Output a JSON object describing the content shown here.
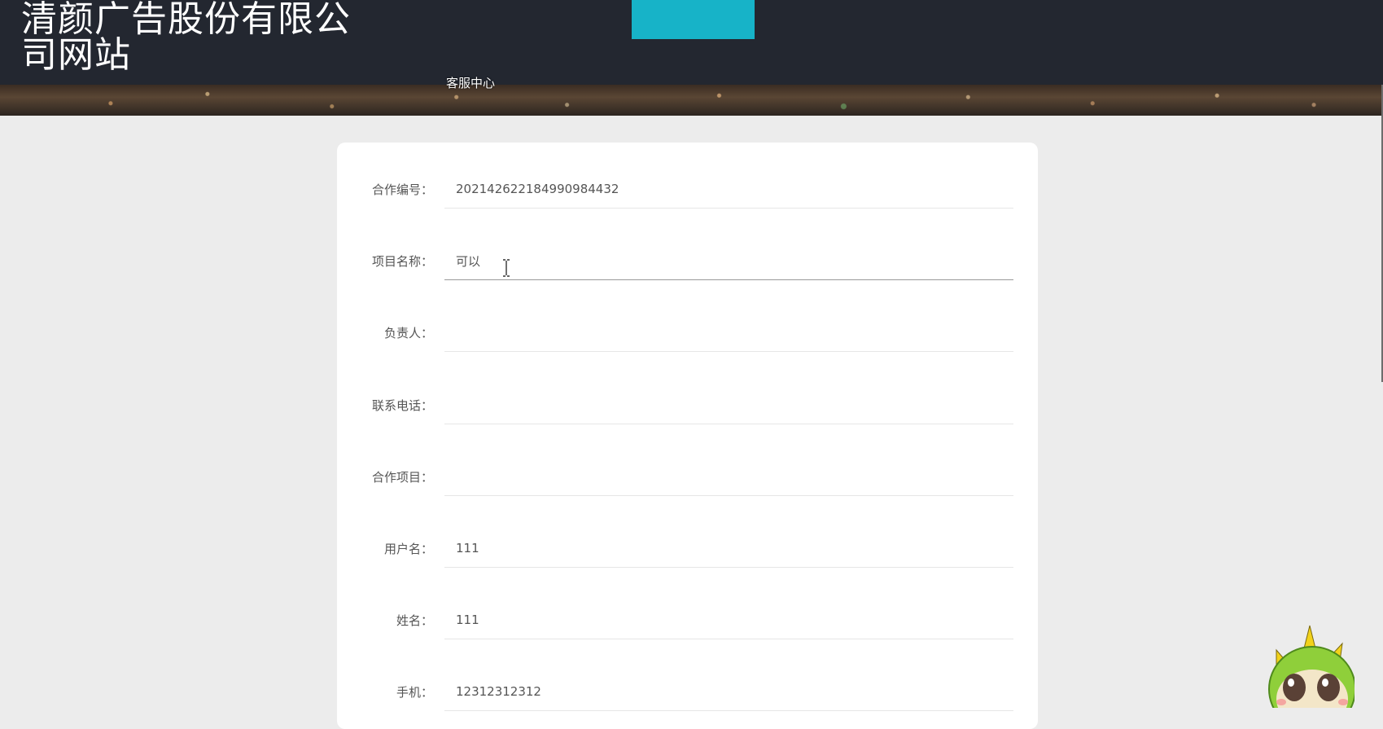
{
  "header": {
    "site_title": "清颜广告股份有限公司网站",
    "nav": {
      "customer_service": "客服中心"
    }
  },
  "form": {
    "fields": [
      {
        "label": "合作编号：",
        "value": "20214262218499098443​2",
        "placeholder": ""
      },
      {
        "label": "项目名称：",
        "value": "可以",
        "placeholder": ""
      },
      {
        "label": "负责人：",
        "value": "",
        "placeholder": ""
      },
      {
        "label": "联系电话：",
        "value": "",
        "placeholder": ""
      },
      {
        "label": "合作项目：",
        "value": "",
        "placeholder": ""
      },
      {
        "label": "用户名：",
        "value": "111",
        "placeholder": ""
      },
      {
        "label": "姓名：",
        "value": "111",
        "placeholder": ""
      },
      {
        "label": "手机：",
        "value": "12312312312",
        "placeholder": ""
      }
    ]
  },
  "colors": {
    "header_bg": "#232730",
    "nav_active": "#17b3c8",
    "page_bg": "#ececec",
    "card_bg": "#ffffff"
  },
  "icons": {
    "text_cursor": "i-beam-cursor-icon",
    "mascot": "green-dinosaur-mascot-icon"
  }
}
